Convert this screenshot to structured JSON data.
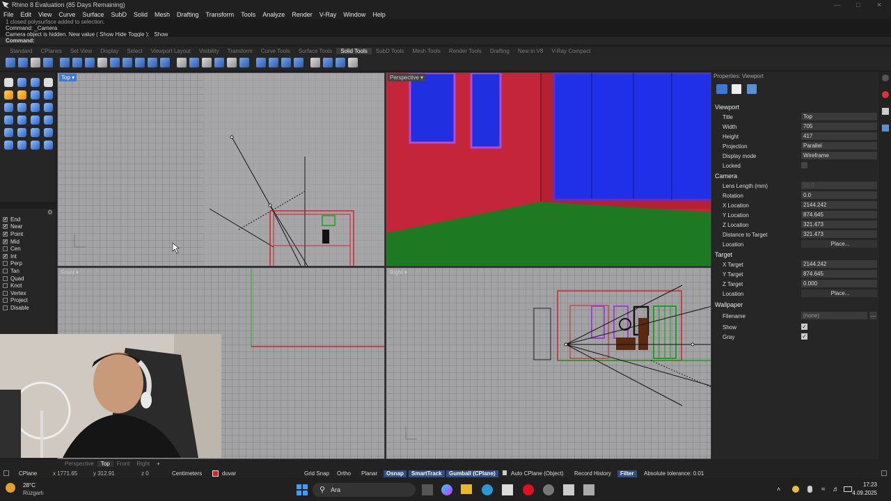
{
  "window": {
    "title": "Rhino 8 Evaluation (85 Days Remaining)"
  },
  "menu": [
    "File",
    "Edit",
    "View",
    "Curve",
    "Surface",
    "SubD",
    "Solid",
    "Mesh",
    "Drafting",
    "Transform",
    "Tools",
    "Analyze",
    "Render",
    "V-Ray",
    "Window",
    "Help"
  ],
  "command_history": [
    "1 closed polysurface added to selection.",
    "Command: _Camera",
    "Camera object is hidden. New value ( Show  Hide  Toggle ): _Show"
  ],
  "command_prompt": "Command:",
  "toolbar_tabs": [
    "Standard",
    "CPlanes",
    "Set View",
    "Display",
    "Select",
    "Viewport Layout",
    "Visibility",
    "Transform",
    "Curve Tools",
    "Surface Tools",
    "Solid Tools",
    "SubD Tools",
    "Mesh Tools",
    "Render Tools",
    "Drafting",
    "New in V8",
    "V-Ray Compact"
  ],
  "active_toolbar_tab": "Solid Tools",
  "osnaps": [
    {
      "label": "End",
      "checked": true
    },
    {
      "label": "Near",
      "checked": true
    },
    {
      "label": "Point",
      "checked": true
    },
    {
      "label": "Mid",
      "checked": true
    },
    {
      "label": "Cen",
      "checked": false
    },
    {
      "label": "Int",
      "checked": true
    },
    {
      "label": "Perp",
      "checked": false
    },
    {
      "label": "Tan",
      "checked": false
    },
    {
      "label": "Quad",
      "checked": false
    },
    {
      "label": "Knot",
      "checked": false
    },
    {
      "label": "Vertex",
      "checked": false
    },
    {
      "label": "Project",
      "checked": false
    },
    {
      "label": "Disable",
      "checked": false
    }
  ],
  "viewports": {
    "top": "Top",
    "perspective": "Perspective",
    "front": "Front",
    "right": "Right"
  },
  "properties": {
    "panel_title": "Properties: Viewport",
    "viewport_section": "Viewport",
    "title_label": "Title",
    "title_value": "Top",
    "width_label": "Width",
    "width_value": "705",
    "height_label": "Height",
    "height_value": "417",
    "projection_label": "Projection",
    "projection_value": "Parallel",
    "display_label": "Display mode",
    "display_value": "Wireframe",
    "locked_label": "Locked",
    "camera_section": "Camera",
    "lens_label": "Lens Length (mm)",
    "lens_value": "50.0",
    "rotation_label": "Rotation",
    "rotation_value": "0.0",
    "xloc_label": "X Location",
    "xloc_value": "2144.242",
    "yloc_label": "Y Location",
    "yloc_value": "874.645",
    "zloc_label": "Z Location",
    "zloc_value": "321.473",
    "dist_label": "Distance to Target",
    "dist_value": "321.473",
    "location_label": "Location",
    "place_label": "Place...",
    "target_section": "Target",
    "xtgt_label": "X Target",
    "xtgt_value": "2144.242",
    "ytgt_label": "Y Target",
    "ytgt_value": "874.645",
    "ztgt_label": "Z Target",
    "ztgt_value": "0.000",
    "tloc_label": "Location",
    "tplace_label": "Place...",
    "wallpaper_section": "Wallpaper",
    "filename_label": "Filename",
    "filename_value": "(none)",
    "show_label": "Show",
    "gray_label": "Gray"
  },
  "viewport_tabs": [
    "Perspective",
    "Top",
    "Front",
    "Right"
  ],
  "active_viewport_tab": "Top",
  "status": {
    "cplane": "CPlane",
    "x": "x 1771.65",
    "y": "y 312.91",
    "z": "z 0",
    "units": "Centimeters",
    "layer": "duvar",
    "layer_color": "#d42020",
    "grid_snap": "Grid Snap",
    "ortho": "Ortho",
    "planar": "Planar",
    "osnap": "Osnap",
    "smarttrack": "SmartTrack",
    "gumball": "Gumball (CPlane)",
    "auto_cplane": "Auto CPlane (Object)",
    "record_history": "Record History",
    "filter": "Filter",
    "tolerance": "Absolute tolerance: 0.01"
  },
  "taskbar": {
    "weather_temp": "28°C",
    "weather_loc": "Rüzgarlı",
    "search": "Ara",
    "time": "17:23",
    "date": "4.09.2025"
  },
  "colors": {
    "accent": "#3c78d8",
    "wall_red": "#c4253a",
    "window_blue": "#1f2ee8",
    "floor_green": "#1e7a22"
  }
}
